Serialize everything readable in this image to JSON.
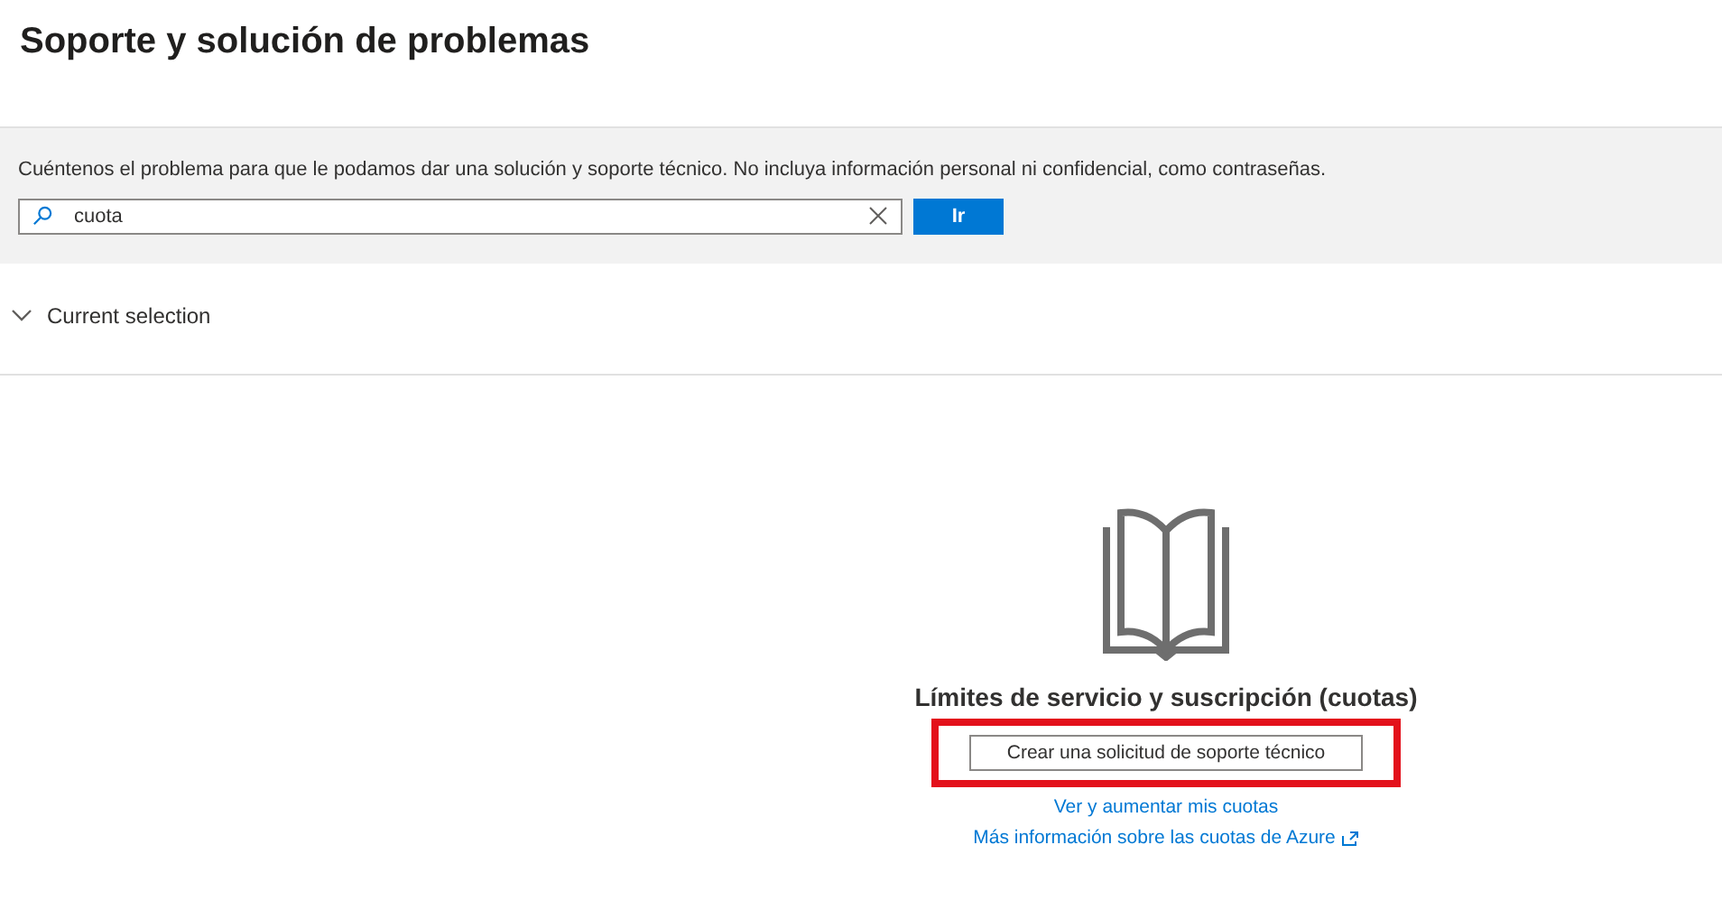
{
  "page_title": "Soporte y solución de problemas",
  "search_panel": {
    "description": "Cuéntenos el problema para que le podamos dar una solución y soporte técnico. No incluya información personal ni confidencial, como contraseñas.",
    "search_value": "cuota",
    "go_button": "Ir"
  },
  "current_selection": {
    "label": "Current selection",
    "expanded": false
  },
  "result": {
    "title": "Límites de servicio y suscripción (cuotas)",
    "action_button": "Crear una solicitud de soporte técnico",
    "highlighted": true,
    "links": [
      {
        "label": "Ver y aumentar mis cuotas",
        "external": false
      },
      {
        "label": "Más información sobre las cuotas de Azure",
        "external": true
      }
    ]
  }
}
